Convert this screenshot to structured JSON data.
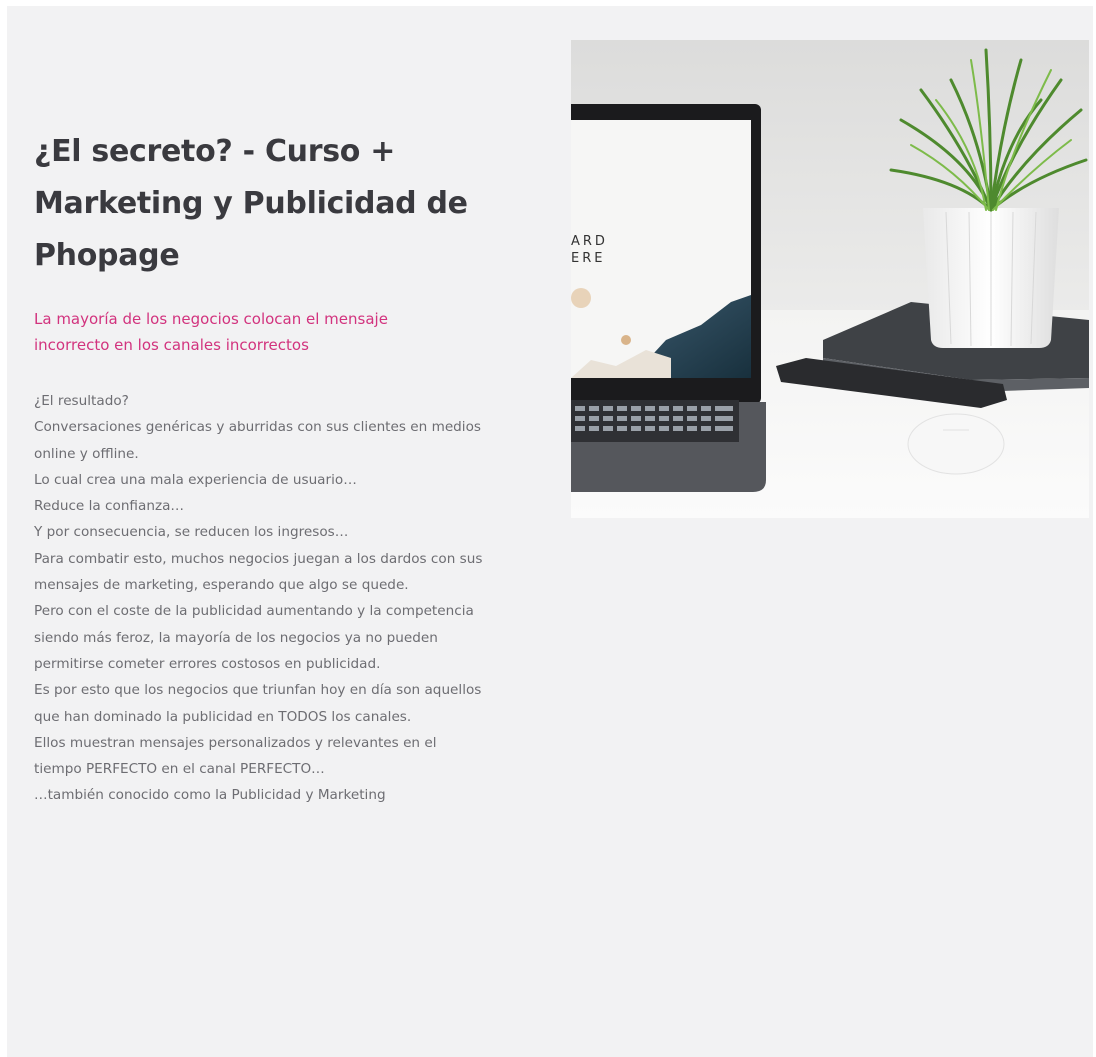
{
  "header": {
    "title": "¿El secreto? - Curso + Marketing y Publicidad de Phopage",
    "subtitle": "La mayoría de los negocios colocan el mensaje incorrecto en los canales incorrectos"
  },
  "body": {
    "paragraphs": [
      "¿El resultado?",
      "Conversaciones genéricas y aburridas con sus clientes en medios online y offline.",
      "Lo cual crea una mala experiencia de usuario…",
      "Reduce la confianza…",
      "Y por consecuencia, se reducen los ingresos…",
      "Para combatir esto, muchos negocios juegan a los dardos con sus mensajes de marketing, esperando que algo se quede.",
      "Pero con el coste de la publicidad aumentando y la competencia siendo más feroz, la mayoría de los negocios ya no pueden permitirse cometer errores costosos en publicidad.",
      "Es por esto que los negocios que triunfan hoy en día son aquellos que han dominado la publicidad en TODOS los canales.",
      "Ellos muestran mensajes personalizados y relevantes en el tiempo PERFECTO en el canal PERFECTO…",
      "…también conocido como la Publicidad y Marketing"
    ]
  },
  "image": {
    "description_icon": "laptop-plant-photo",
    "screen_text_line1": "ARD",
    "screen_text_line2": "ERE"
  },
  "colors": {
    "background": "#f2f2f3",
    "title": "#3a3a3f",
    "subtitle_accent": "#d2337e",
    "body_text": "#6d6d72"
  }
}
